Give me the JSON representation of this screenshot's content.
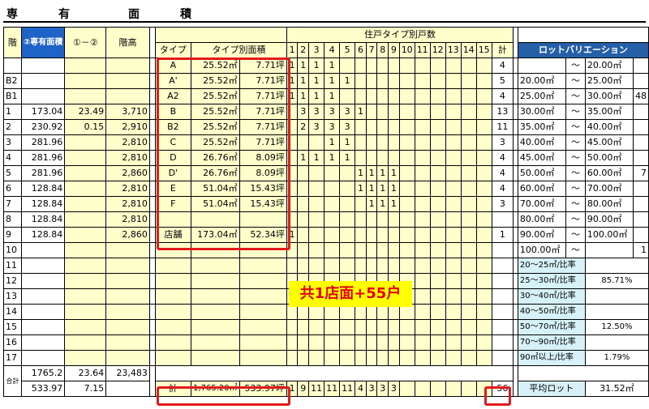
{
  "title_chars": [
    "専",
    "有",
    "面",
    "積"
  ],
  "headers": {
    "kai": "階",
    "senyu": "②専有面積",
    "diff": "①－②",
    "kaidaka": "階高",
    "type": "タイプ",
    "type_area": "タイプ別面積",
    "unit_count": "住戸タイプ別戸数",
    "total": "計",
    "lot_variation": "ロットバリエーション"
  },
  "col_numbers": [
    "1",
    "2",
    "3",
    "4",
    "5",
    "6",
    "7",
    "8",
    "9",
    "10",
    "11",
    "12",
    "13",
    "14",
    "15"
  ],
  "floors": [
    {
      "kai": "",
      "senyu": "",
      "diff": "",
      "kaidaka": ""
    },
    {
      "kai": "B2",
      "senyu": "",
      "diff": "",
      "kaidaka": ""
    },
    {
      "kai": "B1",
      "senyu": "",
      "diff": "",
      "kaidaka": ""
    },
    {
      "kai": "1",
      "senyu": "173.04",
      "diff": "23.49",
      "kaidaka": "3,710"
    },
    {
      "kai": "2",
      "senyu": "230.92",
      "diff": "0.15",
      "kaidaka": "2,910"
    },
    {
      "kai": "3",
      "senyu": "281.96",
      "diff": "",
      "kaidaka": "2,810"
    },
    {
      "kai": "4",
      "senyu": "281.96",
      "diff": "",
      "kaidaka": "2,810"
    },
    {
      "kai": "5",
      "senyu": "281.96",
      "diff": "",
      "kaidaka": "2,860"
    },
    {
      "kai": "6",
      "senyu": "128.84",
      "diff": "",
      "kaidaka": "2,810"
    },
    {
      "kai": "7",
      "senyu": "128.84",
      "diff": "",
      "kaidaka": "2,810"
    },
    {
      "kai": "8",
      "senyu": "128.84",
      "diff": "",
      "kaidaka": "2,810"
    },
    {
      "kai": "9",
      "senyu": "128.84",
      "diff": "",
      "kaidaka": "2,860"
    },
    {
      "kai": "10",
      "senyu": "",
      "diff": "",
      "kaidaka": ""
    },
    {
      "kai": "11",
      "senyu": "",
      "diff": "",
      "kaidaka": ""
    },
    {
      "kai": "12",
      "senyu": "",
      "diff": "",
      "kaidaka": ""
    },
    {
      "kai": "13",
      "senyu": "",
      "diff": "",
      "kaidaka": ""
    },
    {
      "kai": "14",
      "senyu": "",
      "diff": "",
      "kaidaka": ""
    },
    {
      "kai": "15",
      "senyu": "",
      "diff": "",
      "kaidaka": ""
    },
    {
      "kai": "16",
      "senyu": "",
      "diff": "",
      "kaidaka": ""
    },
    {
      "kai": "17",
      "senyu": "",
      "diff": "",
      "kaidaka": ""
    }
  ],
  "types": [
    {
      "type": "A",
      "area": "25.52㎡",
      "tsubo": "7.71坪",
      "counts": [
        "1",
        "1",
        "1",
        "1",
        "",
        "",
        "",
        "",
        "",
        "",
        "",
        "",
        "",
        "",
        ""
      ],
      "total": "4"
    },
    {
      "type": "A'",
      "area": "25.52㎡",
      "tsubo": "7.71坪",
      "counts": [
        "1",
        "1",
        "1",
        "1",
        "1",
        "",
        "",
        "",
        "",
        "",
        "",
        "",
        "",
        "",
        ""
      ],
      "total": "5"
    },
    {
      "type": "A2",
      "area": "25.52㎡",
      "tsubo": "7.71坪",
      "counts": [
        "1",
        "1",
        "1",
        "1",
        "",
        "",
        "",
        "",
        "",
        "",
        "",
        "",
        "",
        "",
        ""
      ],
      "total": "4"
    },
    {
      "type": "B",
      "area": "25.52㎡",
      "tsubo": "7.71坪",
      "counts": [
        "",
        "3",
        "3",
        "3",
        "3",
        "1",
        "",
        "",
        "",
        "",
        "",
        "",
        "",
        "",
        ""
      ],
      "total": "13"
    },
    {
      "type": "B2",
      "area": "25.52㎡",
      "tsubo": "7.71坪",
      "counts": [
        "",
        "2",
        "3",
        "3",
        "3",
        "",
        "",
        "",
        "",
        "",
        "",
        "",
        "",
        "",
        ""
      ],
      "total": "11"
    },
    {
      "type": "C",
      "area": "25.52㎡",
      "tsubo": "7.71坪",
      "counts": [
        "",
        "",
        "",
        "1",
        "1",
        "",
        "",
        "",
        "",
        "",
        "",
        "",
        "",
        "",
        ""
      ],
      "total": "3"
    },
    {
      "type": "D",
      "area": "26.76㎡",
      "tsubo": "8.09坪",
      "counts": [
        "",
        "1",
        "1",
        "1",
        "1",
        "",
        "",
        "",
        "",
        "",
        "",
        "",
        "",
        "",
        ""
      ],
      "total": "4"
    },
    {
      "type": "D'",
      "area": "26.76㎡",
      "tsubo": "8.09坪",
      "counts": [
        "",
        "",
        "",
        "",
        "",
        "1",
        "1",
        "1",
        "1",
        "",
        "",
        "",
        "",
        "",
        ""
      ],
      "total": "4"
    },
    {
      "type": "E",
      "area": "51.04㎡",
      "tsubo": "15.43坪",
      "counts": [
        "",
        "",
        "",
        "",
        "",
        "1",
        "1",
        "1",
        "1",
        "",
        "",
        "",
        "",
        "",
        ""
      ],
      "total": "4"
    },
    {
      "type": "F",
      "area": "51.04㎡",
      "tsubo": "15.43坪",
      "counts": [
        "",
        "",
        "",
        "",
        "",
        "",
        "1",
        "1",
        "1",
        "",
        "",
        "",
        "",
        "",
        ""
      ],
      "total": "3"
    },
    {
      "type": "",
      "area": "",
      "tsubo": "",
      "counts": [
        "",
        "",
        "",
        "",
        "",
        "",
        "",
        "",
        "",
        "",
        "",
        "",
        "",
        "",
        ""
      ],
      "total": ""
    },
    {
      "type": "店舗",
      "area": "173.04㎡",
      "tsubo": "52.34坪",
      "counts": [
        "1",
        "",
        "",
        "",
        "",
        "",
        "",
        "",
        "",
        "",
        "",
        "",
        "",
        "",
        ""
      ],
      "total": "1"
    }
  ],
  "lots": [
    {
      "from": "",
      "to": "20.00㎡",
      "count": ""
    },
    {
      "from": "20.00㎡",
      "to": "25.00㎡",
      "count": ""
    },
    {
      "from": "25.00㎡",
      "to": "30.00㎡",
      "count": "48"
    },
    {
      "from": "30.00㎡",
      "to": "35.00㎡",
      "count": ""
    },
    {
      "from": "35.00㎡",
      "to": "40.00㎡",
      "count": ""
    },
    {
      "from": "40.00㎡",
      "to": "45.00㎡",
      "count": ""
    },
    {
      "from": "45.00㎡",
      "to": "50.00㎡",
      "count": ""
    },
    {
      "from": "50.00㎡",
      "to": "60.00㎡",
      "count": "7"
    },
    {
      "from": "60.00㎡",
      "to": "70.00㎡",
      "count": ""
    },
    {
      "from": "70.00㎡",
      "to": "80.00㎡",
      "count": ""
    },
    {
      "from": "80.00㎡",
      "to": "90.00㎡",
      "count": ""
    },
    {
      "from": "90.00㎡",
      "to": "100.00㎡",
      "count": ""
    },
    {
      "from": "100.00㎡",
      "to": "",
      "count": "1"
    }
  ],
  "tilde": "～",
  "ratios": [
    {
      "label": "20～25㎡/比率",
      "value": ""
    },
    {
      "label": "25～30㎡/比率",
      "value": "85.71%"
    },
    {
      "label": "30～40㎡/比率",
      "value": ""
    },
    {
      "label": "40～50㎡/比率",
      "value": ""
    },
    {
      "label": "50～70㎡/比率",
      "value": "12.50%"
    },
    {
      "label": "70～90㎡/比率",
      "value": ""
    },
    {
      "label": "90㎡以上/比率",
      "value": "1.79%"
    }
  ],
  "gokei": {
    "label": "合計",
    "senyu1": "1765.2",
    "diff1": "23.64",
    "kaidaka1": "23,483",
    "senyu2": "533.97",
    "diff2": "7.15",
    "total_label": "計",
    "total_area": "1,765.20㎡",
    "total_tsubo": "533.97坪",
    "column_totals": [
      "1",
      "9",
      "11",
      "11",
      "11",
      "4",
      "3",
      "3",
      "3",
      "",
      "",
      "",
      "",
      "",
      ""
    ],
    "grand_total": "56",
    "avg_label": "平均ロット",
    "avg_value": "31.52㎡"
  },
  "callout": "共1店面+55户"
}
